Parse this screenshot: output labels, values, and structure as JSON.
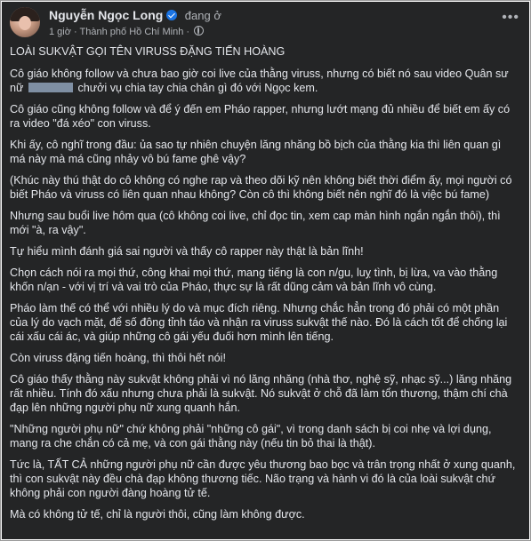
{
  "post": {
    "author": "Nguyễn Ngọc Long",
    "status_text": "đang ở",
    "time": "1 giờ",
    "separator": "·",
    "location": "Thành phố Hồ Chí Minh",
    "privacy_separator": "·",
    "icons": {
      "avatar": "profile-photo",
      "verified": "verified-badge-icon",
      "privacy": "globe-icon",
      "more": "more-options-icon"
    },
    "colors": {
      "background": "#242526",
      "text": "#e4e6eb",
      "secondary_text": "#b0b3b8",
      "verified": "#1b74e4",
      "redaction": "#7f8fa3"
    },
    "title": "LOÀI SUKVẬT GỌI TÊN VIRUSS ĐẶNG TIẾN HOÀNG",
    "p1_a": "Cô giáo không follow và chưa bao giờ coi live của thằng viruss, nhưng có biết nó sau video Quân sư nữ",
    "p1_b": "chưởi vụ chia tay chia chân gì đó với Ngọc kem.",
    "p2": "Cô giáo cũng không follow và để ý đến em Pháo rapper, nhưng lướt mạng đủ nhiều để biết em ấy có ra video \"đá xéo\" con viruss.",
    "p3": "Khi ấy, cô nghĩ trong đầu: ủa sao tự nhiên chuyện lăng nhăng bồ bịch của thằng kia thì liên quan gì má này mà má cũng nhảy vô bú fame ghê vậy?",
    "p4": "(Khúc này thú thật do cô không có nghe rap và theo dõi kỹ nên không biết thời điểm ấy, mọi người có biết Pháo và viruss có liên quan nhau không? Còn cô thì không biết nên nghĩ đó là việc bú fame)",
    "p5": "Nhưng sau buổi live hôm qua (cô không coi live, chỉ đọc tin, xem cap màn hình ngắn ngắn thôi), thì mới \"à, ra vậy\".",
    "p6": "Tự hiểu mình đánh giá sai người và thấy cô rapper này thật là bản lĩnh!",
    "p7": "Chọn cách nói ra mọi thứ, công khai mọi thứ, mang tiếng là con n/gu, luỵ tình, bị lừa, va vào thằng khốn n/ạn - với vị trí và vai trò của Pháo, thực sự là rất dũng cảm và bản lĩnh vô cùng.",
    "p8": "Pháo làm thế có thể với nhiều lý do và mục đích riêng. Nhưng chắc hẳn trong đó phải có một phần của lý do vạch mặt, để số đông tỉnh táo và nhận ra viruss sukvật thế nào. Đó là cách tốt để chống lại cái xấu cái ác, và giúp những cô gái yếu đuối hơn mình lên tiếng.",
    "p9": "Còn viruss đặng tiến hoàng, thì thôi hết nói!",
    "p10": "Cô giáo thấy thằng này sukvật không phải vì nó lăng nhăng (nhà thơ, nghệ sỹ, nhạc sỹ...) lăng nhăng rất nhiều. Tính đó xấu nhưng chưa phải là sukvật. Nó sukvật ở chỗ đã làm tổn thương, thậm chí chà đạp lên những người phụ nữ xung quanh hắn.",
    "p11": "\"Những người phụ nữ\" chứ không phải \"những cô gái\", vì trong danh sách bị coi nhẹ và lợi dụng, mang ra che chắn có cả mẹ, và con gái thằng này (nếu tin bỏ thai là thật).",
    "p12": "Tức là, TẤT CẢ những người phụ nữ cần được yêu thương bao bọc và trân trọng nhất ở xung quanh, thì con sukvật này đều chà đạp không thương tiếc. Não trạng và hành vi đó là của loài sukvật chứ không phải con người đàng hoàng tử tế.",
    "p13": "Mà có không tử tế, chỉ là người thôi, cũng làm không được."
  }
}
